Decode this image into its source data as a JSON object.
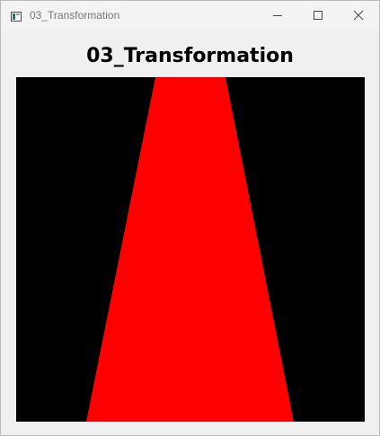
{
  "window": {
    "title": "03_Transformation",
    "controls": {
      "minimize_icon": "minimize-icon",
      "maximize_icon": "maximize-icon",
      "close_icon": "close-icon"
    }
  },
  "content": {
    "heading": "03_Transformation"
  },
  "render": {
    "background_color": "#000000",
    "shape": "trapezoid",
    "shape_color": "#ff0000"
  }
}
